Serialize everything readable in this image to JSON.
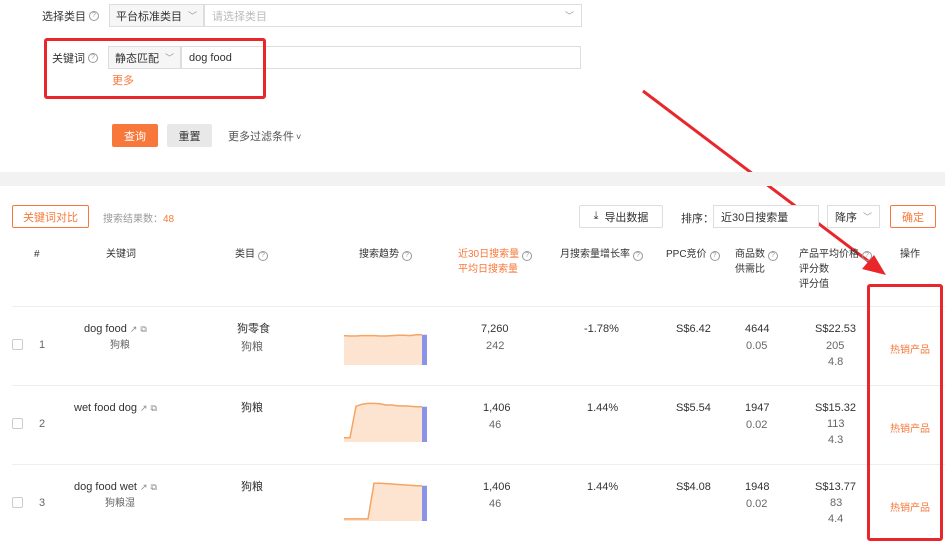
{
  "filters": {
    "category_label": "选择类目",
    "category_select": "平台标准类目",
    "category_placeholder": "请选择类目",
    "keyword_label": "关键词",
    "match_select": "静态匹配",
    "keyword_value": "dog food",
    "more_link": "更多",
    "query_button": "查询",
    "reset_button": "重置",
    "more_filters": "更多过滤条件"
  },
  "toolbar": {
    "compare_button": "关键词对比",
    "result_count_label": "搜索结果数：",
    "result_count": "48",
    "export_button": "导出数据",
    "sort_label": "排序：",
    "sort_value": "近30日搜索量",
    "order_value": "降序",
    "confirm_button": "确定"
  },
  "table": {
    "headers": {
      "index": "#",
      "keyword": "关键词",
      "category": "类目",
      "trend": "搜索趋势",
      "search30_line1": "近30日搜索量",
      "search30_line2": "平均日搜索量",
      "growth": "月搜索量增长率",
      "ppc": "PPC竞价",
      "goods_line1": "商品数",
      "goods_line2": "供需比",
      "price_line1": "产品平均价格",
      "price_line2": "评分数",
      "price_line3": "评分值",
      "action": "操作"
    },
    "rows": [
      {
        "index": "1",
        "keyword": "dog food",
        "keyword_cn": "狗粮",
        "category1": "狗零食",
        "category2": "狗粮",
        "search30": "7,260",
        "avg_daily": "242",
        "growth": "-1.78%",
        "ppc": "S$6.42",
        "goods": "4644",
        "ratio": "0.05",
        "price": "S$22.53",
        "rating_count": "205",
        "rating": "4.8",
        "action": "热销产品",
        "trend": [
          0.3,
          0.31,
          0.31,
          0.3,
          0.3,
          0.3,
          0.31,
          0.31,
          0.3,
          0.29,
          0.29,
          0.3,
          0.28,
          0.28
        ]
      },
      {
        "index": "2",
        "keyword": "wet food dog",
        "keyword_cn": "",
        "category1": "狗粮",
        "category2": "",
        "search30": "1,406",
        "avg_daily": "46",
        "growth": "1.44%",
        "ppc": "S$5.54",
        "goods": "1947",
        "ratio": "0.02",
        "price": "S$15.32",
        "rating_count": "113",
        "rating": "4.3",
        "action": "热销产品",
        "trend": [
          0.9,
          0.9,
          0.15,
          0.1,
          0.08,
          0.08,
          0.09,
          0.12,
          0.12,
          0.14,
          0.14,
          0.15,
          0.16,
          0.16
        ]
      },
      {
        "index": "3",
        "keyword": "dog food wet",
        "keyword_cn": "狗粮湿",
        "category1": "狗粮",
        "category2": "",
        "search30": "1,406",
        "avg_daily": "46",
        "growth": "1.44%",
        "ppc": "S$4.08",
        "goods": "1948",
        "ratio": "0.02",
        "price": "S$13.77",
        "rating_count": "83",
        "rating": "4.4",
        "action": "热销产品",
        "trend": [
          0.95,
          0.95,
          0.95,
          0.95,
          0.95,
          0.1,
          0.1,
          0.11,
          0.12,
          0.13,
          0.14,
          0.15,
          0.16,
          0.16
        ]
      }
    ]
  },
  "colors": {
    "accent": "#f7783a",
    "annotation": "#e8262b",
    "trend_fill": "#fde4d0",
    "trend_line": "#f5a463",
    "trend_marker": "#8a93e6"
  }
}
